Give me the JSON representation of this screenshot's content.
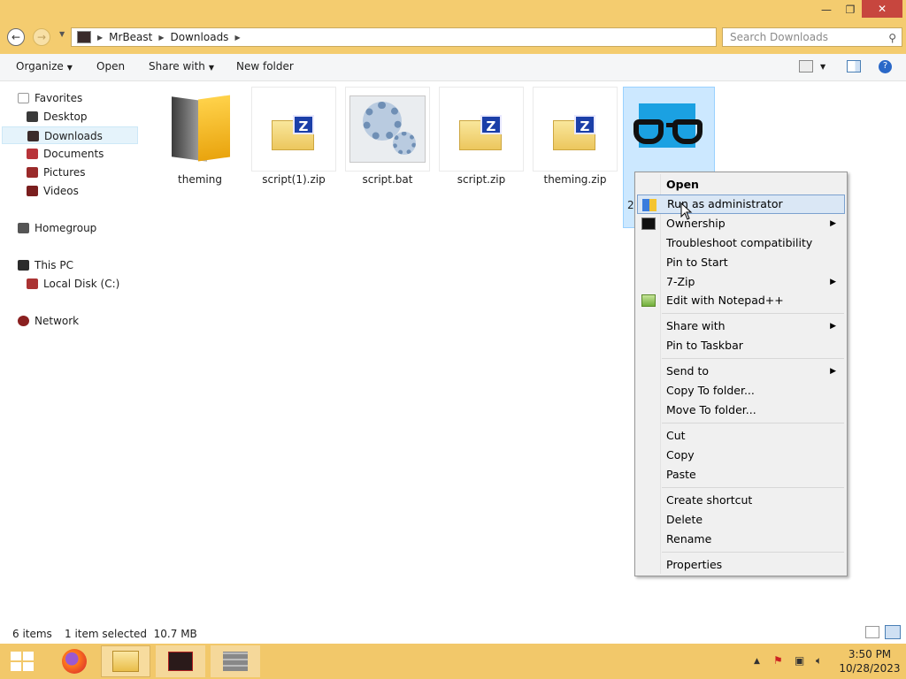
{
  "window": {
    "controls": {
      "minimize": "—",
      "maximize": "❐",
      "close": "✕"
    }
  },
  "address": {
    "crumbs": [
      "MrBeast",
      "Downloads"
    ],
    "search_placeholder": "Search Downloads"
  },
  "toolbar": {
    "organize": "Organize",
    "open": "Open",
    "share_with": "Share with",
    "new_folder": "New folder"
  },
  "nav": {
    "favorites": "Favorites",
    "desktop": "Desktop",
    "downloads": "Downloads",
    "documents": "Documents",
    "pictures": "Pictures",
    "videos": "Videos",
    "homegroup": "Homegroup",
    "this_pc": "This PC",
    "local_disk": "Local Disk (C:)",
    "network": "Network"
  },
  "files": [
    {
      "name": "theming",
      "icon": "folder-icon"
    },
    {
      "name": "script(1).zip",
      "icon": "zip-icon"
    },
    {
      "name": "script.bat",
      "icon": "batch-gear-icon"
    },
    {
      "name": "script.zip",
      "icon": "zip-icon"
    },
    {
      "name": "theming.zip",
      "icon": "zip-icon"
    },
    {
      "name": "2",
      "icon": "app-glasses-icon"
    }
  ],
  "context_menu": {
    "open": "Open",
    "run_as_admin": "Run as administrator",
    "ownership": "Ownership",
    "troubleshoot": "Troubleshoot compatibility",
    "pin_start": "Pin to Start",
    "seven_zip": "7-Zip",
    "edit_notepad": "Edit with Notepad++",
    "share_with": "Share with",
    "pin_taskbar": "Pin to Taskbar",
    "send_to": "Send to",
    "copy_to": "Copy To folder...",
    "move_to": "Move To folder...",
    "cut": "Cut",
    "copy": "Copy",
    "paste": "Paste",
    "create_shortcut": "Create shortcut",
    "delete": "Delete",
    "rename": "Rename",
    "properties": "Properties"
  },
  "status": {
    "items": "6 items",
    "selection": "1 item selected  10.7 MB"
  },
  "clock": {
    "time": "3:50 PM",
    "date": "10/28/2023"
  },
  "colors": {
    "accent": "#f4cc6f",
    "selection": "#cce8ff",
    "highlight": "#dae7f5"
  }
}
